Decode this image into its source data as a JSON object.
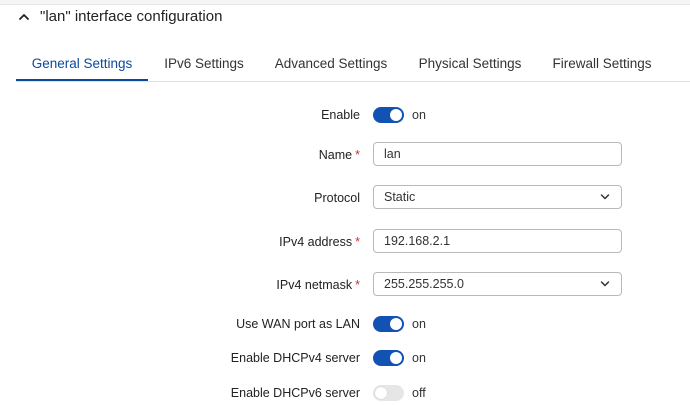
{
  "header": {
    "title": "\"lan\" interface configuration",
    "collapse_icon": "chevron-up-icon"
  },
  "tabs": [
    {
      "label": "General Settings",
      "active": true
    },
    {
      "label": "IPv6 Settings",
      "active": false
    },
    {
      "label": "Advanced Settings",
      "active": false
    },
    {
      "label": "Physical Settings",
      "active": false
    },
    {
      "label": "Firewall Settings",
      "active": false
    }
  ],
  "form": {
    "enable": {
      "label": "Enable",
      "state": "on"
    },
    "name": {
      "label": "Name",
      "required_mark": "*",
      "value": "lan"
    },
    "protocol": {
      "label": "Protocol",
      "value": "Static"
    },
    "ipv4_address": {
      "label": "IPv4 address",
      "required_mark": "*",
      "value": "192.168.2.1"
    },
    "ipv4_netmask": {
      "label": "IPv4 netmask",
      "required_mark": "*",
      "value": "255.255.255.0"
    },
    "use_wan_as_lan": {
      "label": "Use WAN port as LAN",
      "state": "on"
    },
    "dhcpv4": {
      "label": "Enable DHCPv4 server",
      "state": "on"
    },
    "dhcpv6": {
      "label": "Enable DHCPv6 server",
      "state": "off"
    }
  },
  "colors": {
    "accent": "#0b4a9a",
    "toggle_on": "#1252b5",
    "toggle_off": "#e6e6e6",
    "required": "#d32f2f"
  }
}
